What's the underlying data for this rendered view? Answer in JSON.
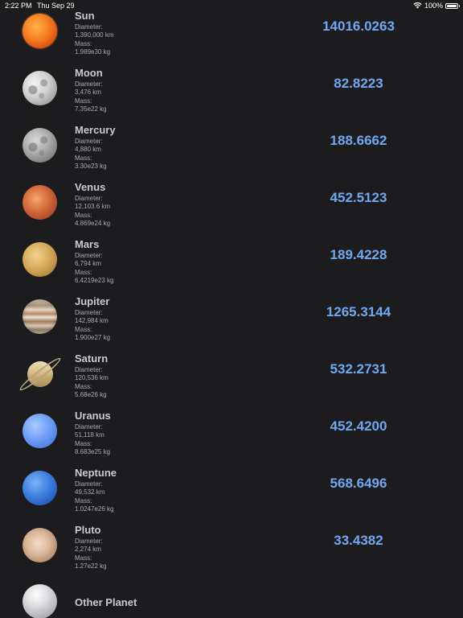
{
  "status_bar": {
    "time": "2:22 PM",
    "date": "Thu Sep 29",
    "battery": "100%"
  },
  "planets": [
    {
      "name": "Sun",
      "diameter_label": "Diameter:",
      "diameter": "1,390,000 km",
      "mass_label": "Mass:",
      "mass": "1.989e30 kg",
      "value": "14016.0263",
      "icon": "sun-icon"
    },
    {
      "name": "Moon",
      "diameter_label": "Diameter:",
      "diameter": "3,476 km",
      "mass_label": "Mass:",
      "mass": "7.35e22 kg",
      "value": "82.8223",
      "icon": "moon-icon"
    },
    {
      "name": "Mercury",
      "diameter_label": "Diameter:",
      "diameter": "4,880 km",
      "mass_label": "Mass:",
      "mass": "3.30e23 kg",
      "value": "188.6662",
      "icon": "mercury-icon"
    },
    {
      "name": "Venus",
      "diameter_label": "Diameter:",
      "diameter": "12,103.6 km",
      "mass_label": "Mass:",
      "mass": "4.869e24 kg",
      "value": "452.5123",
      "icon": "venus-icon"
    },
    {
      "name": "Mars",
      "diameter_label": "Diameter:",
      "diameter": "6,794 km",
      "mass_label": "Mass:",
      "mass": "6.4219e23 kg",
      "value": "189.4228",
      "icon": "mars-icon"
    },
    {
      "name": "Jupiter",
      "diameter_label": "Diameter:",
      "diameter": "142,984 km",
      "mass_label": "Mass:",
      "mass": "1.900e27 kg",
      "value": "1265.3144",
      "icon": "jupiter-icon"
    },
    {
      "name": "Saturn",
      "diameter_label": "Diameter:",
      "diameter": "120,536 km",
      "mass_label": "Mass:",
      "mass": "5.68e26 kg",
      "value": "532.2731",
      "icon": "saturn-icon"
    },
    {
      "name": "Uranus",
      "diameter_label": "Diameter:",
      "diameter": "51,118 km",
      "mass_label": "Mass:",
      "mass": "8.683e25 kg",
      "value": "452.4200",
      "icon": "uranus-icon"
    },
    {
      "name": "Neptune",
      "diameter_label": "Diameter:",
      "diameter": "49,532 km",
      "mass_label": "Mass:",
      "mass": "1.0247e26 kg",
      "value": "568.6496",
      "icon": "neptune-icon"
    },
    {
      "name": "Pluto",
      "diameter_label": "Diameter:",
      "diameter": "2,274 km",
      "mass_label": "Mass:",
      "mass": "1.27e22 kg",
      "value": "33.4382",
      "icon": "pluto-icon"
    }
  ],
  "other_planet": {
    "name": "Other Planet",
    "icon": "other-planet-icon"
  },
  "colors": {
    "background": "#1c1c1e",
    "value_text": "#6fa8f0"
  }
}
